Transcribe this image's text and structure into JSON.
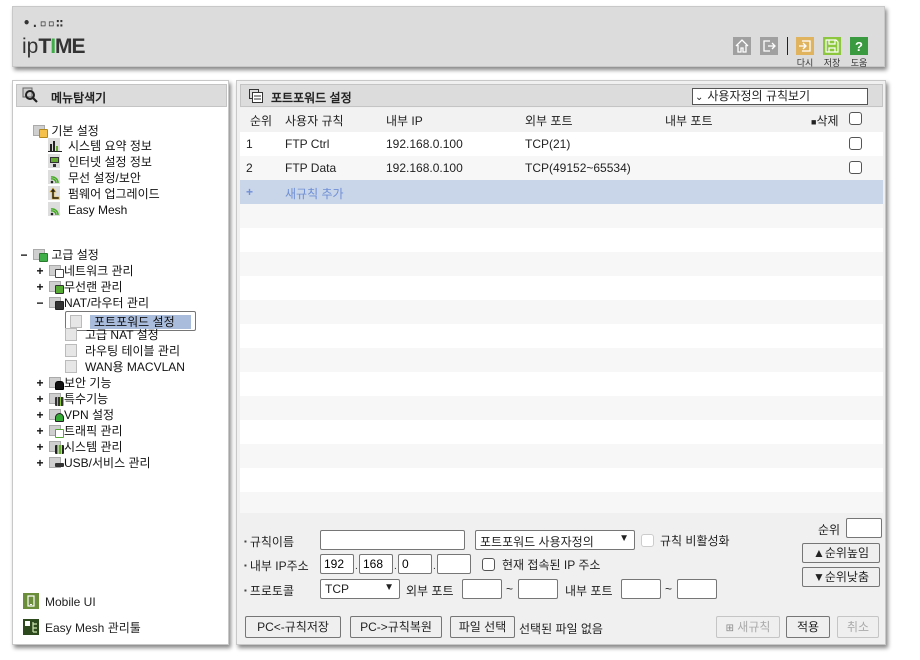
{
  "header": {
    "logo_dots": "•.▫▫∷",
    "logo_prefix": "ip",
    "logo_T": "T",
    "logo_I": "I",
    "logo_ME": "ME",
    "buttons": [
      {
        "name": "home",
        "icon": "home-icon",
        "label": ""
      },
      {
        "name": "logout",
        "icon": "logout-icon",
        "label": ""
      },
      {
        "name": "reload",
        "icon": "reload-icon",
        "label": "다시",
        "color": "#e0b35e"
      },
      {
        "name": "save",
        "icon": "save-icon",
        "label": "저장",
        "color": "#8dc63f"
      },
      {
        "name": "help",
        "icon": "help-icon",
        "label": "도움",
        "color": "#3a9a3f"
      }
    ]
  },
  "sidebar": {
    "title": "메뉴탐색기",
    "basic": {
      "label": "기본 설정",
      "items": [
        "시스템 요약 정보",
        "인터넷 설정 정보",
        "무선 설정/보안",
        "펌웨어 업그레이드",
        "Easy Mesh"
      ]
    },
    "advanced": {
      "label": "고급 설정",
      "expander": "−",
      "groups": [
        {
          "label": "네트워크 관리",
          "expander": "+"
        },
        {
          "label": "무선랜 관리",
          "expander": "+"
        },
        {
          "label": "NAT/라우터 관리",
          "expander": "−",
          "children": [
            "포트포워드 설정",
            "고급 NAT 설정",
            "라우팅 테이블 관리",
            "WAN용 MACVLAN"
          ],
          "selected": "포트포워드 설정"
        },
        {
          "label": "보안 기능",
          "expander": "+"
        },
        {
          "label": "특수기능",
          "expander": "+"
        },
        {
          "label": "VPN 설정",
          "expander": "+"
        },
        {
          "label": "트래픽 관리",
          "expander": "+"
        },
        {
          "label": "시스템 관리",
          "expander": "+"
        },
        {
          "label": "USB/서비스 관리",
          "expander": "+"
        }
      ]
    },
    "footer": [
      {
        "label": "Mobile UI",
        "icon": "mobile-icon"
      },
      {
        "label": "Easy Mesh 관리툴",
        "icon": "mesh-tool-icon"
      }
    ]
  },
  "main": {
    "title": "포트포워드 설정",
    "view_select": "사용자정의 규칙보기",
    "columns": [
      "순위",
      "사용자 규칙",
      "내부 IP",
      "외부 포트",
      "내부 포트",
      "삭제"
    ],
    "rows": [
      {
        "rank": "1",
        "name": "FTP Ctrl",
        "internal_ip": "192.168.0.100",
        "external_port": "TCP(21)",
        "internal_port": ""
      },
      {
        "rank": "2",
        "name": "FTP Data",
        "internal_ip": "192.168.0.100",
        "external_port": "TCP(49152~65534)",
        "internal_port": ""
      }
    ],
    "add_row": {
      "icon": "+",
      "label": "새규칙 추가"
    },
    "form": {
      "rule_name_label": "규칙이름",
      "rule_name_value": "",
      "rule_type_select": "포트포워드 사용자정의",
      "disable_label": "규칙 비활성화",
      "ip_label": "내부 IP주소",
      "ip_octets": [
        "192",
        "168",
        "0",
        ""
      ],
      "current_ip_label": "현재 접속된 IP 주소",
      "protocol_label": "프로토콜",
      "protocol_value": "TCP",
      "ext_port_label": "외부 포트",
      "int_port_label": "내부 포트",
      "tilde": "~",
      "rank_label": "순위",
      "rank_value": "",
      "rank_up": "▲순위높임",
      "rank_down": "▼순위낮춤"
    },
    "bottom": {
      "pc_save": "PC<-규칙저장",
      "pc_restore": "PC->규칙복원",
      "file_select": "파일 선택",
      "file_status": "선택된 파일 없음",
      "new_rule": "새규칙",
      "apply": "적용",
      "cancel": "취소"
    }
  }
}
